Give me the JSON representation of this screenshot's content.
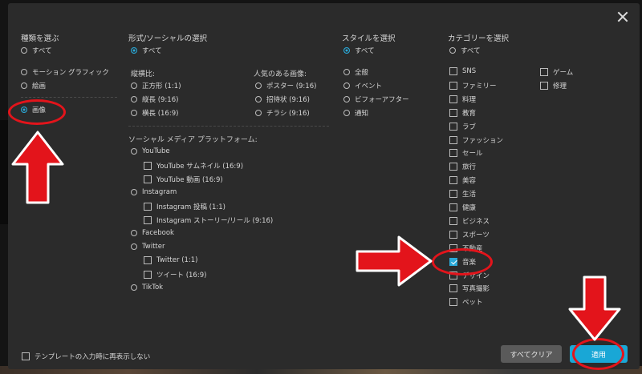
{
  "colors": {
    "accent": "#19a7d6",
    "annotation": "#e3141b"
  },
  "type_section": {
    "header": "種類を選ぶ",
    "all": "すべて",
    "options": [
      "モーション グラフィック",
      "絵画"
    ],
    "image": "画像"
  },
  "format_section": {
    "header": "形式/ソーシャルの選択",
    "all": "すべて",
    "aspect_header": "縦横比:",
    "aspect_options": [
      "正方形 (1:1)",
      "縦長 (9:16)",
      "横長 (16:9)"
    ],
    "popular_header": "人気のある画像:",
    "popular_options": [
      "ポスター (9:16)",
      "招待状 (9:16)",
      "チラシ (9:16)"
    ],
    "social_header": "ソーシャル メディア プラットフォーム:",
    "platforms": [
      {
        "name": "YouTube",
        "children": [
          "YouTube サムネイル (16:9)",
          "YouTube 動画 (16:9)"
        ]
      },
      {
        "name": "Instagram",
        "children": [
          "Instagram 投稿 (1:1)",
          "Instagram ストーリー/リール (9:16)"
        ]
      },
      {
        "name": "Facebook",
        "children": []
      },
      {
        "name": "Twitter",
        "children": [
          "Twitter (1:1)",
          "ツイート (16:9)"
        ]
      },
      {
        "name": "TikTok",
        "children": []
      }
    ]
  },
  "style_section": {
    "header": "スタイルを選択",
    "all": "すべて",
    "options": [
      "全般",
      "イベント",
      "ビフォーアフター",
      "通知"
    ]
  },
  "category_section": {
    "header": "カテゴリーを選択",
    "all": "すべて",
    "col1": [
      "SNS",
      "ファミリー",
      "料理",
      "教育",
      "ラブ",
      "ファッション",
      "セール",
      "旅行",
      "美容",
      "生活",
      "健康",
      "ビジネス",
      "スポーツ",
      "不動産",
      "音楽",
      "デザイン",
      "写真撮影",
      "ペット"
    ],
    "col2": [
      "ゲーム",
      "修理"
    ],
    "checked": "音楽"
  },
  "footer": {
    "dont_show": "テンプレートの入力時に再表示しない",
    "clear_all": "すべてクリア",
    "apply": "適用"
  }
}
